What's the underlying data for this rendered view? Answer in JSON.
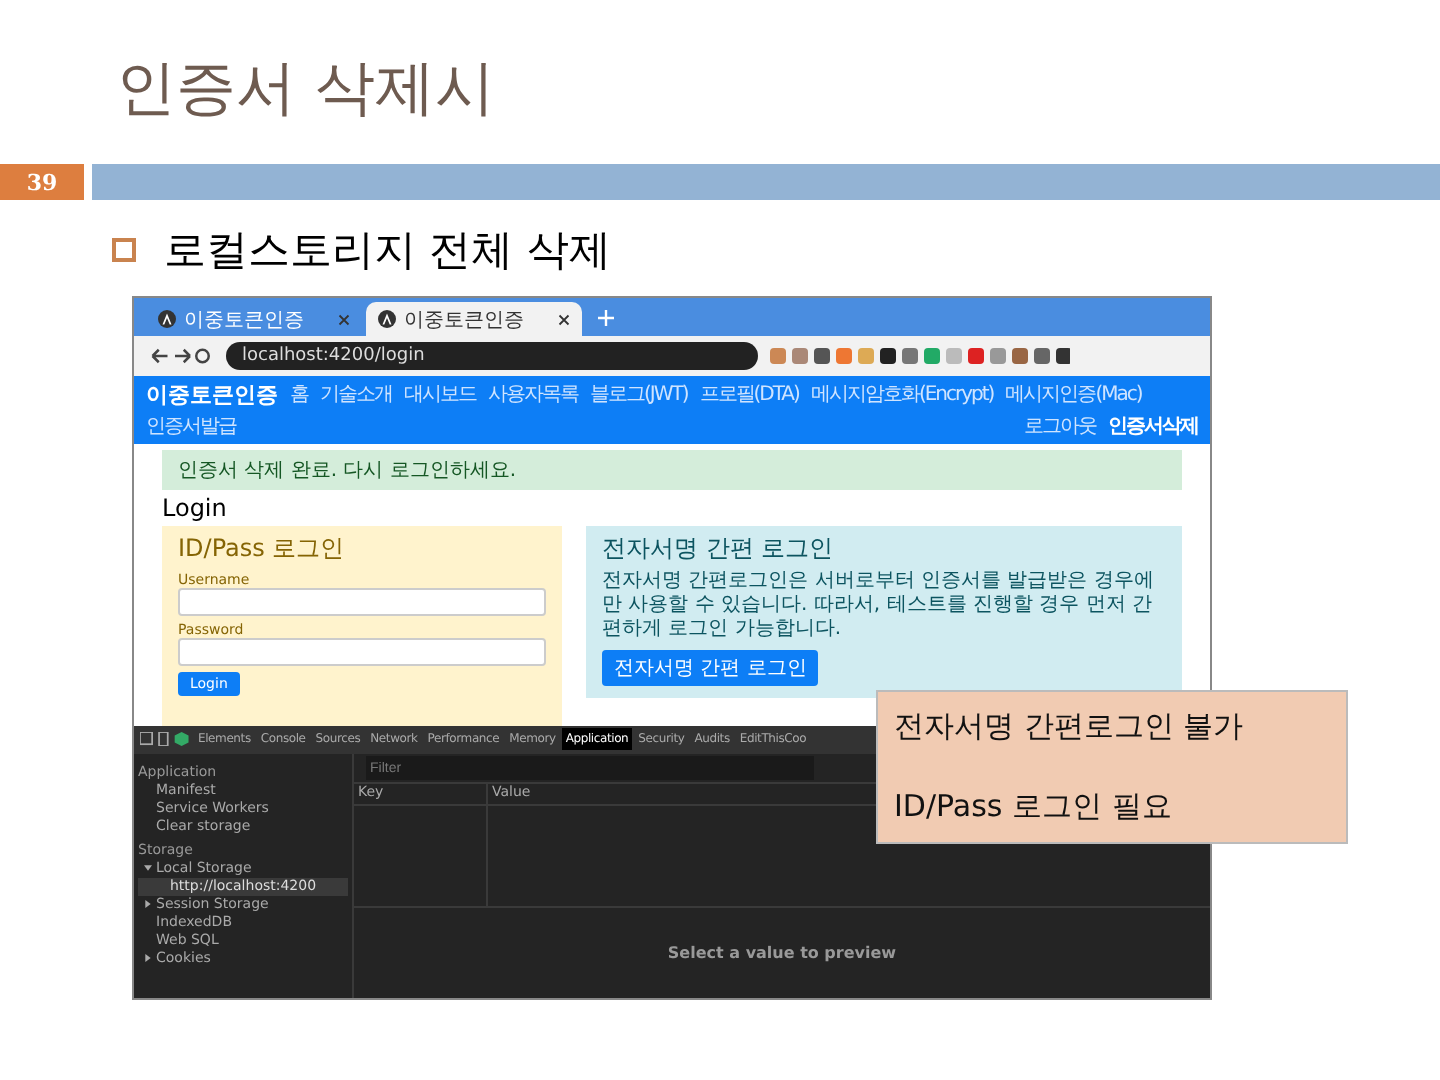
{
  "slide": {
    "title": "인증서 삭제시",
    "page_number": "39",
    "bullet": "로컬스토리지 전체 삭제"
  },
  "browser": {
    "tabs": [
      {
        "label": "이중토큰인증",
        "selected": false
      },
      {
        "label": "이중토큰인증",
        "selected": true
      }
    ],
    "url": "localhost:4200/login",
    "nav": {
      "brand": "이중토큰인증",
      "items": [
        "홈",
        "기술소개",
        "대시보드",
        "사용자목록",
        "블로그(JWT)",
        "프로필(DTA)",
        "메시지암호화(Encrypt)",
        "메시지인증(Mac)",
        "인증서발급"
      ],
      "right": [
        {
          "label": "로그아웃",
          "selected": false
        },
        {
          "label": "인증서삭제",
          "selected": true
        }
      ]
    },
    "alert": "인증서 삭제 완료. 다시 로그인하세요.",
    "heading": "Login",
    "idpass": {
      "title": "ID/Pass 로그인",
      "username_label": "Username",
      "password_label": "Password",
      "button": "Login"
    },
    "sign": {
      "title": "전자서명 간편 로그인",
      "text": "전자서명 간편로그인은 서버로부터 인증서를 발급받은 경우에만 사용할 수 있습니다. 따라서, 테스트를 진행할 경우 먼저 간편하게 로그인 가능합니다.",
      "button": "전자서명 간편 로그인"
    }
  },
  "devtools": {
    "tabs": [
      {
        "label": "Elements",
        "selected": false
      },
      {
        "label": "Console",
        "selected": false
      },
      {
        "label": "Sources",
        "selected": false
      },
      {
        "label": "Network",
        "selected": false
      },
      {
        "label": "Performance",
        "selected": false
      },
      {
        "label": "Memory",
        "selected": false
      },
      {
        "label": "Application",
        "selected": true
      },
      {
        "label": "Security",
        "selected": false
      },
      {
        "label": "Audits",
        "selected": false
      },
      {
        "label": "EditThisCoo",
        "selected": false
      }
    ],
    "sidebar": [
      {
        "heading": "Application",
        "items": [
          {
            "label": "Manifest",
            "selected": false
          },
          {
            "label": "Service Workers",
            "selected": false
          },
          {
            "label": "Clear storage",
            "selected": false
          }
        ]
      },
      {
        "heading": "Storage",
        "items": [
          {
            "label": "Local Storage",
            "selected": false,
            "expanded": true,
            "children": [
              {
                "label": "http://localhost:4200",
                "selected": true
              }
            ]
          },
          {
            "label": "Session Storage",
            "selected": false,
            "expanded": false
          },
          {
            "label": "IndexedDB",
            "selected": false
          },
          {
            "label": "Web SQL",
            "selected": false
          },
          {
            "label": "Cookies",
            "selected": false,
            "expanded": false
          }
        ]
      }
    ],
    "filter_placeholder": "Filter",
    "columns": [
      "Key",
      "Value"
    ],
    "preview": "Select a value to preview"
  },
  "callout": [
    "전자서명 간편로그인 불가",
    "ID/Pass 로그인 필요"
  ]
}
